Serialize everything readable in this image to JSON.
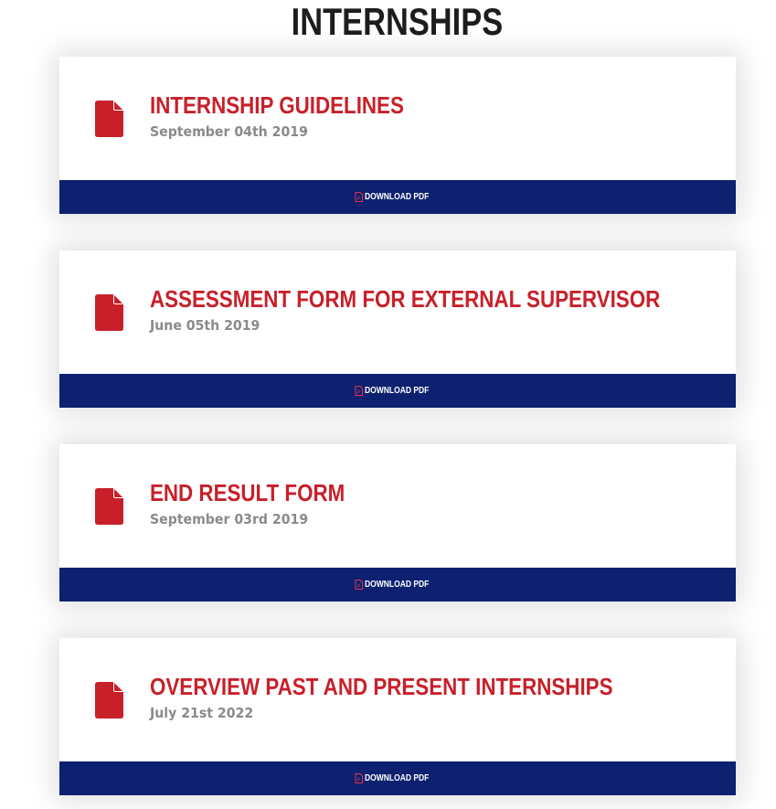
{
  "page": {
    "title": "INTERNSHIPS"
  },
  "colors": {
    "accent_red": "#c8202a",
    "bar_navy": "#0d2170",
    "date_gray": "#8a8a8a"
  },
  "documents": [
    {
      "title": "INTERNSHIP GUIDELINES",
      "date": "September 04th 2019",
      "download_label": "DOWNLOAD PDF",
      "icon": "file-icon"
    },
    {
      "title": "ASSESSMENT FORM FOR EXTERNAL SUPERVISOR",
      "date": "June 05th 2019",
      "download_label": "DOWNLOAD PDF",
      "icon": "file-icon"
    },
    {
      "title": "END RESULT FORM",
      "date": "September 03rd 2019",
      "download_label": "DOWNLOAD PDF",
      "icon": "file-icon"
    },
    {
      "title": "OVERVIEW PAST AND PRESENT INTERNSHIPS",
      "date": "July 21st 2022",
      "download_label": "DOWNLOAD PDF",
      "icon": "file-icon"
    }
  ]
}
